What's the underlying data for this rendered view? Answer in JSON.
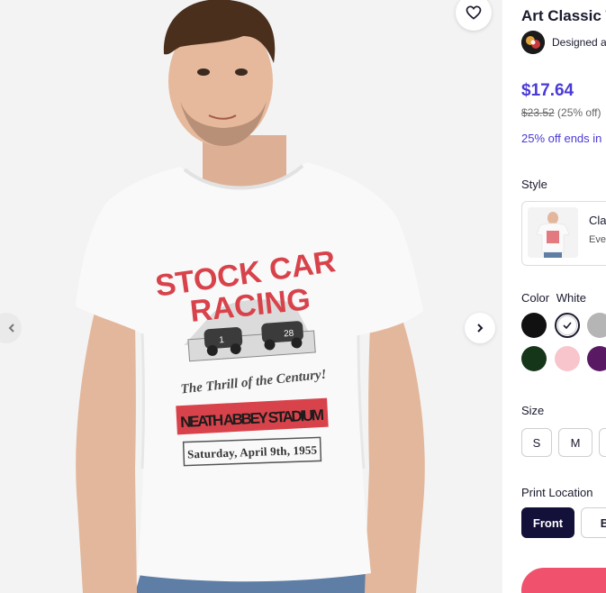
{
  "product": {
    "title": "Art Classic T",
    "designer_text": "Designed ar",
    "price": "$17.64",
    "original_price": "$23.52",
    "discount": "(25% off)",
    "promo": "25% off ends in"
  },
  "shirt_print": {
    "line1": "STOCK CAR",
    "line2": "RACING",
    "tagline": "The Thrill of the Century!",
    "venue": "NEATH ABBEY STADIUM",
    "date": "Saturday, April 9th, 1955",
    "car_number_left": "1",
    "car_number_right": "28"
  },
  "style": {
    "label": "Style",
    "card_name": "Cla",
    "card_sub": "Ever"
  },
  "color": {
    "label": "Color",
    "selected": "White",
    "swatches": [
      {
        "name": "Black",
        "hex": "#111111"
      },
      {
        "name": "White",
        "hex": "#ffffff"
      },
      {
        "name": "Heather Grey",
        "hex": "#b5b5b5"
      },
      {
        "name": "Forest Green",
        "hex": "#16361a"
      },
      {
        "name": "Light Pink",
        "hex": "#f7c5cb"
      },
      {
        "name": "Purple",
        "hex": "#5a1a63"
      }
    ]
  },
  "size": {
    "label": "Size",
    "options": [
      "S",
      "M",
      ""
    ]
  },
  "print_location": {
    "label": "Print Location",
    "front": "Front",
    "back": "Ba"
  },
  "colors": {
    "accent": "#4a3ad6",
    "dark_button": "#13103a",
    "cart": "#f0526d"
  }
}
